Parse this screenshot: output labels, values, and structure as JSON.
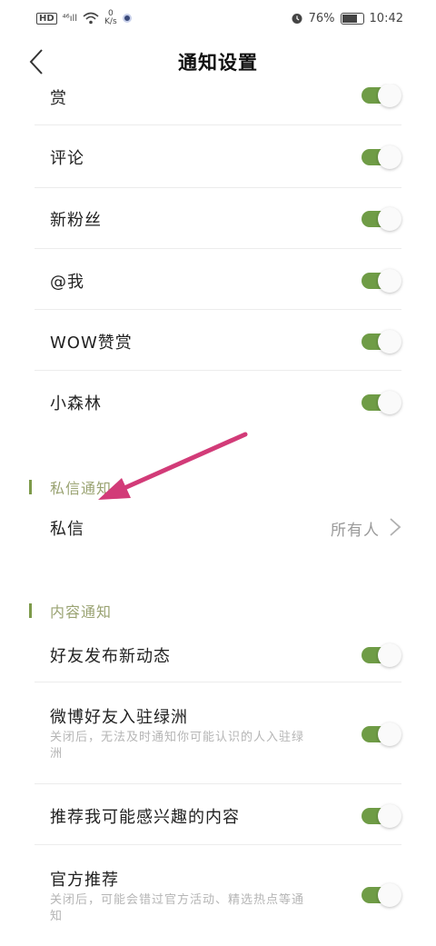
{
  "status_bar": {
    "hd": "HD",
    "signal": "⁴⁶ıll",
    "speed_value": "0",
    "speed_unit": "K/s",
    "alarm_icon": "alarm-icon",
    "battery_percent": "76%",
    "battery_level": 0.76,
    "time": "10:42"
  },
  "header": {
    "title": "通知设置",
    "back_icon": "chevron-left-icon"
  },
  "items_top": [
    {
      "label": "赏",
      "on": true
    },
    {
      "label": "评论",
      "on": true
    },
    {
      "label": "新粉丝",
      "on": true
    },
    {
      "label": "@我",
      "on": true
    },
    {
      "label": "WOW赞赏",
      "on": true
    },
    {
      "label": "小森林",
      "on": true
    }
  ],
  "private_section": {
    "title": "私信通知",
    "item": {
      "label": "私信",
      "value": "所有人"
    }
  },
  "content_section": {
    "title": "内容通知",
    "items": [
      {
        "label": "好友发布新动态",
        "sub": "",
        "on": true
      },
      {
        "label": "微博好友入驻绿洲",
        "sub": "关闭后，无法及时通知你可能认识的人入驻绿洲",
        "on": true
      },
      {
        "label": "推荐我可能感兴趣的内容",
        "sub": "",
        "on": true
      },
      {
        "label": "官方推荐",
        "sub": "关闭后，可能会错过官方活动、精选热点等通知",
        "on": true
      }
    ]
  },
  "colors": {
    "toggle_on": "#6f9c46",
    "accent": "#7d9a4a",
    "annotation_arrow": "#d23b78"
  }
}
